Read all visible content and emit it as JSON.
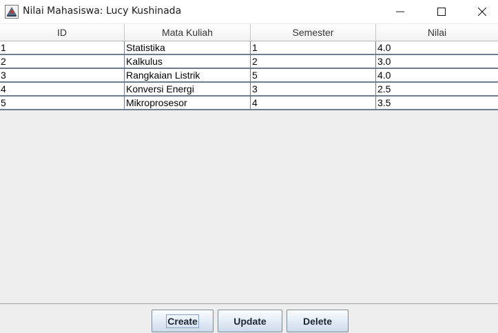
{
  "window": {
    "title": "Nilai Mahasiswa: Lucy Kushinada"
  },
  "table": {
    "columns": [
      "ID",
      "Mata Kuliah",
      "Semester",
      "Nilai"
    ],
    "rows": [
      [
        "1",
        "Statistika",
        "1",
        "4.0"
      ],
      [
        "2",
        "Kalkulus",
        "2",
        "3.0"
      ],
      [
        "3",
        "Rangkaian Listrik",
        "5",
        "4.0"
      ],
      [
        "4",
        "Konversi Energi",
        "3",
        "2.5"
      ],
      [
        "5",
        "Mikroprosesor",
        "4",
        "3.5"
      ]
    ]
  },
  "buttons": {
    "create": "Create",
    "update": "Update",
    "delete": "Delete"
  },
  "icons": {
    "app": "java-app-icon",
    "minimize": "minimize-icon",
    "maximize": "maximize-icon",
    "close": "close-icon"
  }
}
